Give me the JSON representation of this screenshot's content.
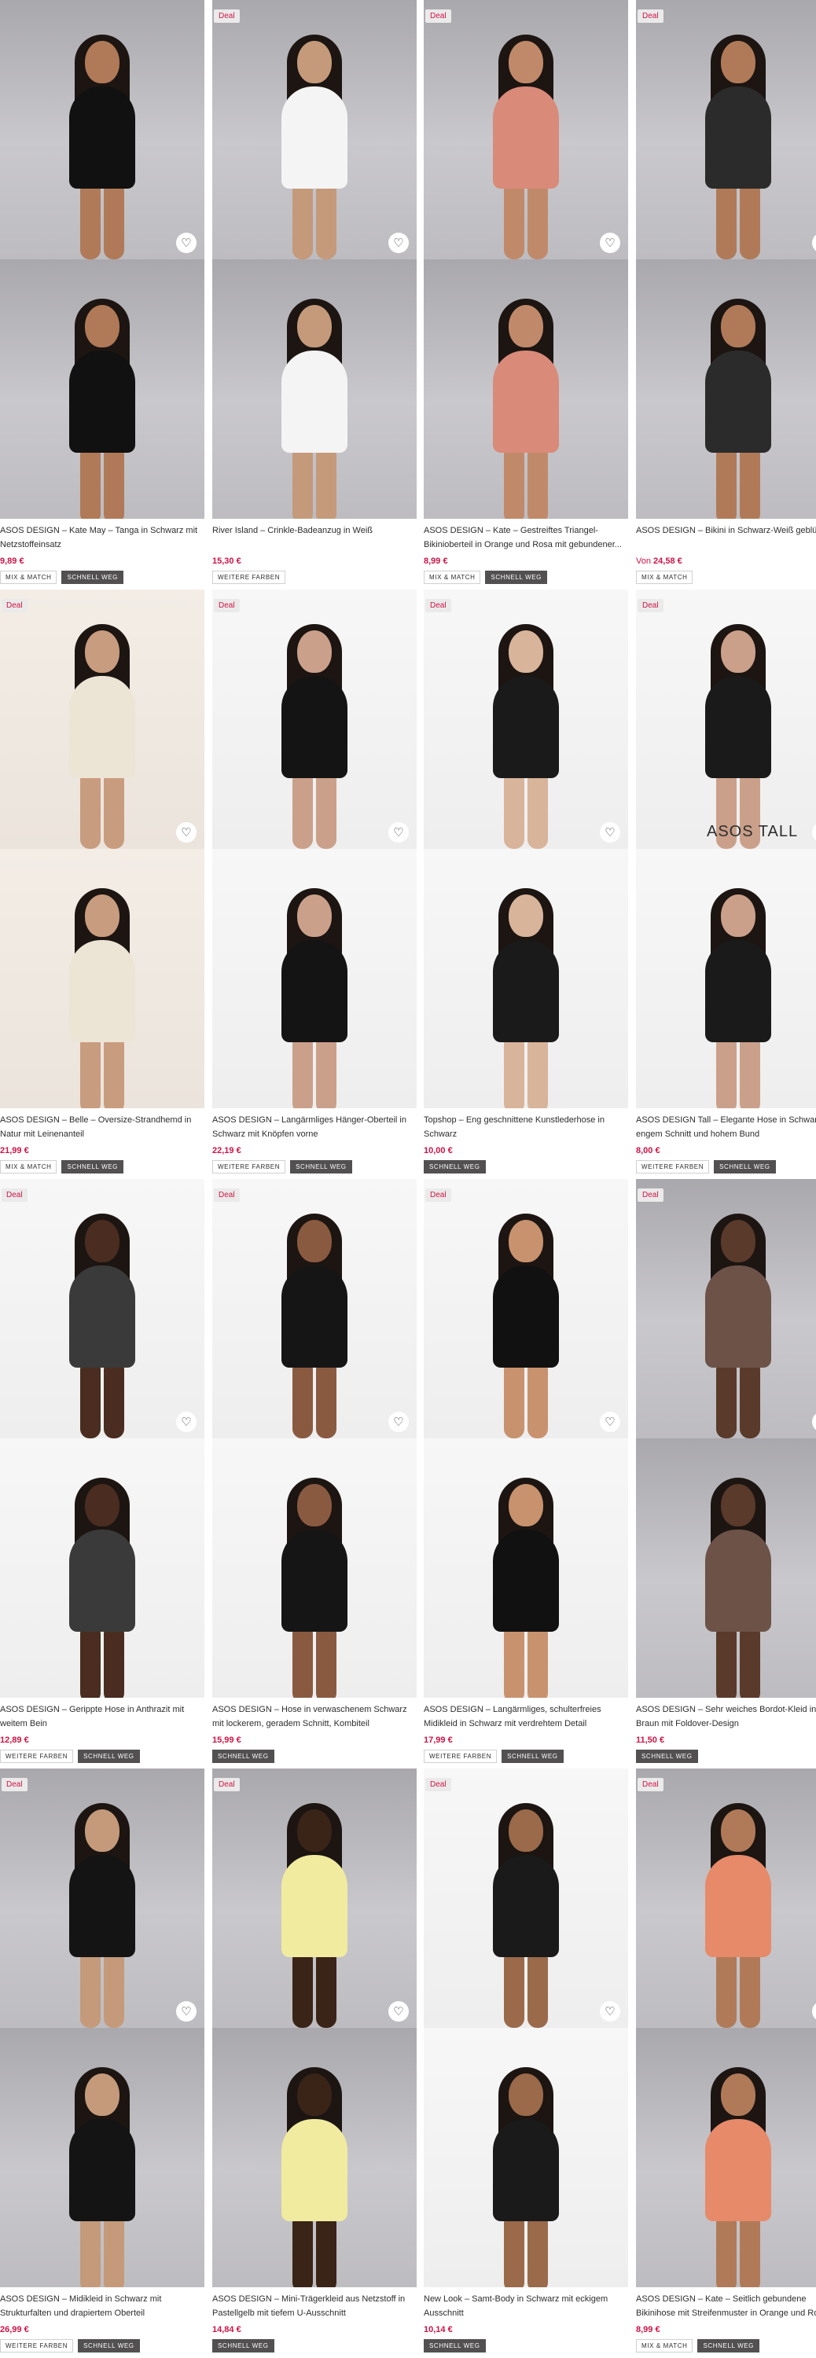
{
  "products": [
    {
      "title": "ASOS DESIGN – Kate May – Tanga in Schwarz mit Netzstoffeinsatz",
      "price": "9,89 €",
      "price_prefix": "",
      "deal": false,
      "tall": false,
      "badges": [
        "MIX & MATCH",
        "SCHNELL WEG"
      ]
    },
    {
      "title": "River Island – Crinkle-Badeanzug in Weiß",
      "price": "15,30 €",
      "price_prefix": "",
      "deal": true,
      "tall": false,
      "badges": [
        "WEITERE FARBEN"
      ]
    },
    {
      "title": "ASOS DESIGN – Kate – Gestreiftes Triangel-Bikinioberteil in Orange und Rosa mit gebundener...",
      "price": "8,99 €",
      "price_prefix": "",
      "deal": true,
      "tall": false,
      "badges": [
        "MIX & MATCH",
        "SCHNELL WEG"
      ]
    },
    {
      "title": "ASOS DESIGN – Bikini in Schwarz-Weiß geblümt",
      "price": "24,58 €",
      "price_prefix": "Von",
      "deal": true,
      "tall": false,
      "badges": [
        "MIX & MATCH"
      ]
    },
    {
      "title": "ASOS DESIGN – Belle – Oversize-Strandhemd in Natur mit Leinenanteil",
      "price": "21,99 €",
      "price_prefix": "",
      "deal": true,
      "tall": false,
      "badges": [
        "MIX & MATCH",
        "SCHNELL WEG"
      ]
    },
    {
      "title": "ASOS DESIGN – Langärmliges Hänger-Oberteil in Schwarz mit Knöpfen vorne",
      "price": "22,19 €",
      "price_prefix": "",
      "deal": true,
      "tall": false,
      "badges": [
        "WEITERE FARBEN",
        "SCHNELL WEG"
      ]
    },
    {
      "title": "Topshop – Eng geschnittene Kunstlederhose in Schwarz",
      "price": "10,00 €",
      "price_prefix": "",
      "deal": true,
      "tall": false,
      "badges": [
        "SCHNELL WEG"
      ]
    },
    {
      "title": "ASOS DESIGN Tall – Elegante Hose in Schwarz mit engem Schnitt und hohem Bund",
      "price": "8,00 €",
      "price_prefix": "",
      "deal": true,
      "tall": true,
      "tall_label": "ASOS TALL",
      "badges": [
        "WEITERE FARBEN",
        "SCHNELL WEG"
      ]
    },
    {
      "title": "ASOS DESIGN – Gerippte Hose in Anthrazit mit weitem Bein",
      "price": "12,89 €",
      "price_prefix": "",
      "deal": true,
      "tall": false,
      "badges": [
        "WEITERE FARBEN",
        "SCHNELL WEG"
      ]
    },
    {
      "title": "ASOS DESIGN – Hose in verwaschenem Schwarz mit lockerem, geradem Schnitt, Kombiteil",
      "price": "15,99 €",
      "price_prefix": "",
      "deal": true,
      "tall": false,
      "badges": [
        "SCHNELL WEG"
      ]
    },
    {
      "title": "ASOS DESIGN – Langärmliges, schulterfreies Midikleid in Schwarz mit verdrehtem Detail",
      "price": "17,99 €",
      "price_prefix": "",
      "deal": true,
      "tall": false,
      "badges": [
        "WEITERE FARBEN",
        "SCHNELL WEG"
      ]
    },
    {
      "title": "ASOS DESIGN – Sehr weiches Bordot-Kleid in Braun mit Foldover-Design",
      "price": "11,50 €",
      "price_prefix": "",
      "deal": true,
      "tall": false,
      "badges": [
        "SCHNELL WEG"
      ]
    },
    {
      "title": "ASOS DESIGN – Midikleid in Schwarz mit Strukturfalten und drapiertem Oberteil",
      "price": "26,99 €",
      "price_prefix": "",
      "deal": true,
      "tall": false,
      "badges": [
        "WEITERE FARBEN",
        "SCHNELL WEG"
      ]
    },
    {
      "title": "ASOS DESIGN – Mini-Trägerkleid aus Netzstoff in Pastellgelb mit tiefem U-Ausschnitt",
      "price": "14,84 €",
      "price_prefix": "",
      "deal": true,
      "tall": false,
      "badges": [
        "SCHNELL WEG"
      ]
    },
    {
      "title": "New Look – Samt-Body in Schwarz mit eckigem Ausschnitt",
      "price": "10,14 €",
      "price_prefix": "",
      "deal": true,
      "tall": false,
      "badges": [
        "SCHNELL WEG"
      ]
    },
    {
      "title": "ASOS DESIGN – Kate – Seitlich gebundene Bikinihose mit Streifenmuster in Orange und Rosa",
      "price": "8,99 €",
      "price_prefix": "",
      "deal": true,
      "tall": false,
      "badges": [
        "MIX & MATCH",
        "SCHNELL WEG"
      ]
    }
  ],
  "deal_label": "Deal",
  "icons": {
    "favourite": "heart-icon"
  },
  "colors": {
    "price": "#d01345",
    "badge_dark": "#525050",
    "deal_text": "#d01345"
  }
}
